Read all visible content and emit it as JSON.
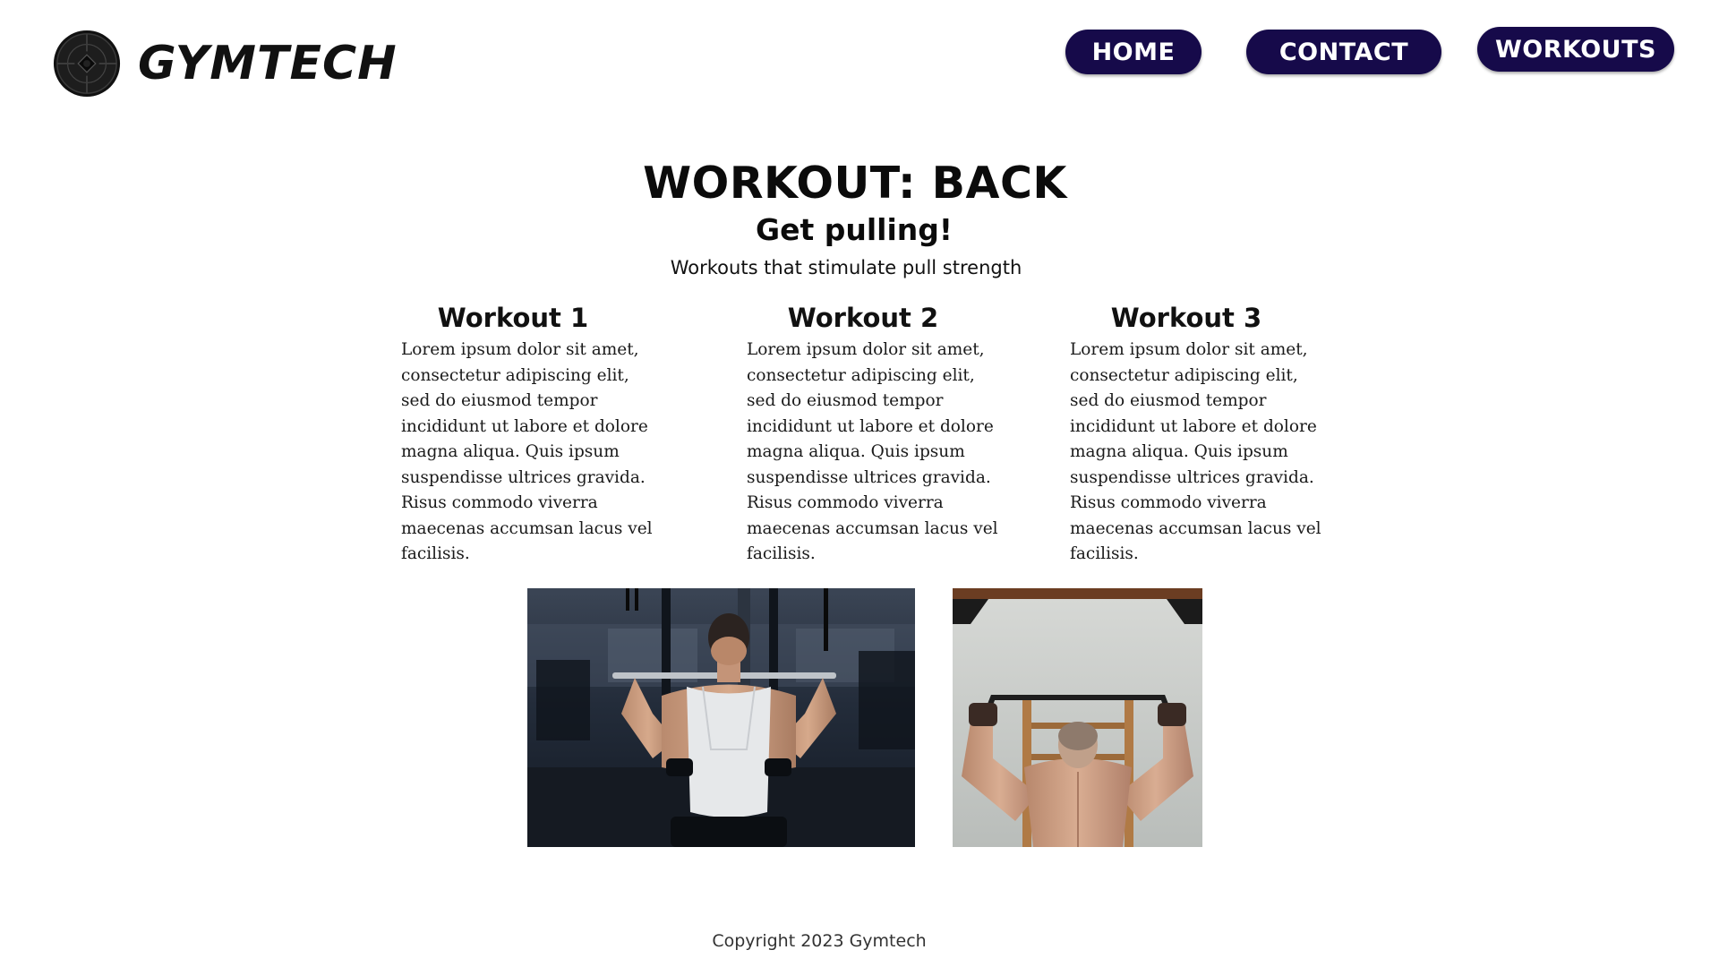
{
  "header": {
    "logo_text": "GYMTECH",
    "logo_icon": "weight-plate-icon"
  },
  "nav": {
    "home": "HOME",
    "contact": "CONTACT",
    "workouts": "WORKOUTS",
    "button_color": "#160a4a"
  },
  "hero": {
    "title": "WORKOUT: BACK",
    "subtitle": "Get pulling!",
    "description": "Workouts that stimulate pull strength"
  },
  "workouts": [
    {
      "title": "Workout 1",
      "body": "Lorem ipsum dolor sit amet, consectetur adipiscing elit, sed do eiusmod tempor incididunt ut labore et dolore magna aliqua. Quis ipsum suspendisse ultrices gravida. Risus commodo viverra maecenas accumsan lacus vel facilisis."
    },
    {
      "title": "Workout 2",
      "body": "Lorem ipsum dolor sit amet, consectetur adipiscing elit, sed do eiusmod tempor incididunt ut labore et dolore magna aliqua. Quis ipsum suspendisse ultrices gravida. Risus commodo viverra maecenas accumsan lacus vel facilisis."
    },
    {
      "title": "Workout 3",
      "body": "Lorem ipsum dolor sit amet, consectetur adipiscing elit, sed do eiusmod tempor incididunt ut labore et dolore magna aliqua. Quis ipsum suspendisse ultrices gravida. Risus commodo viverra maecenas accumsan lacus vel facilisis."
    }
  ],
  "footer": {
    "copyright": "Copyright 2023 Gymtech"
  }
}
